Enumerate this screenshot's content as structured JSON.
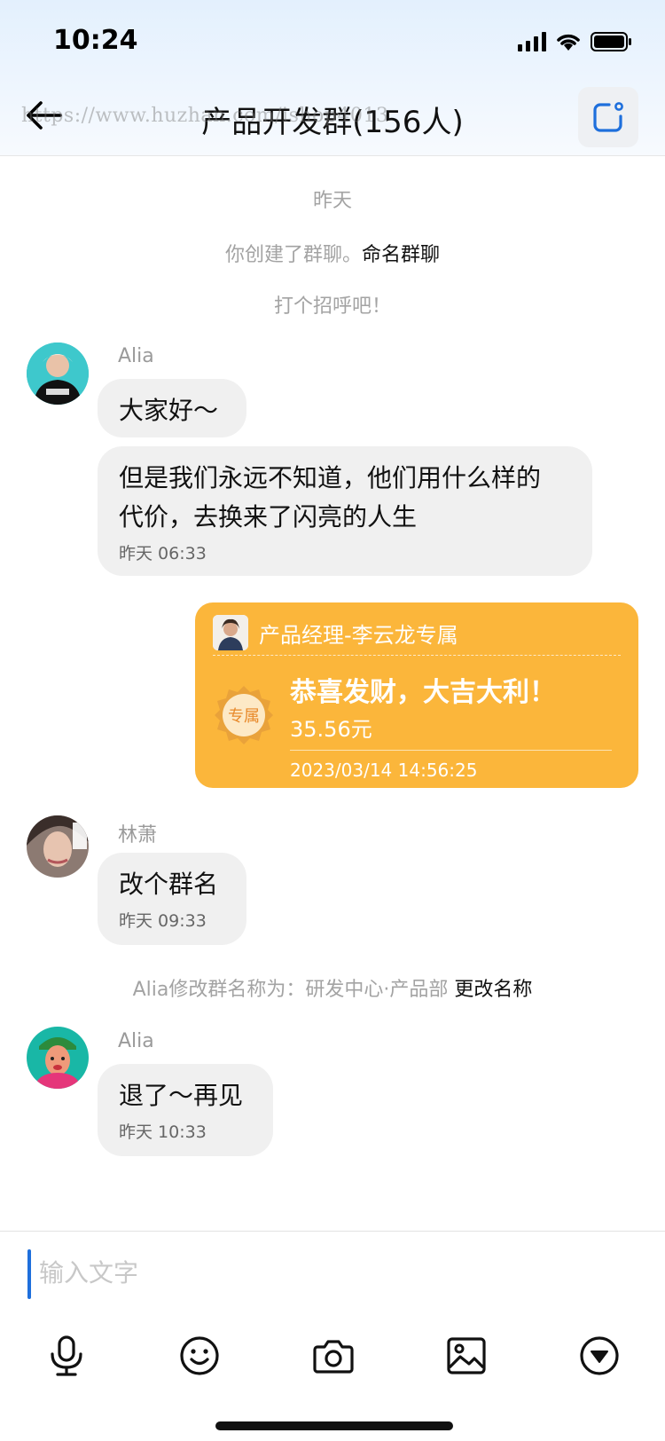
{
  "status_bar": {
    "time": "10:24"
  },
  "nav": {
    "title": "产品开发群(156人)",
    "watermark": "https://www.huzhan.com/ishop4013"
  },
  "system": {
    "date_label": "昨天",
    "created_text": "你创建了群聊。",
    "rename_link": "命名群聊",
    "greet_hint": "打个招呼吧！",
    "renamed_text": "Alia修改群名称为：研发中心·产品部",
    "change_name_link": "更改名称"
  },
  "messages": [
    {
      "sender": "Alia",
      "text": "大家好～"
    },
    {
      "text_line1": "但是我们永远不知道，他们用什么样的",
      "text_line2": "代价，去换来了闪亮的人生",
      "time": "昨天 06:33"
    },
    {
      "sender": "林萧",
      "text": "改个群名",
      "time": "昨天 09:33"
    },
    {
      "sender": "Alia",
      "text": "退了～再见",
      "time": "昨天 10:33"
    }
  ],
  "packet": {
    "sender": "产品经理-李云龙专属",
    "seal_text": "专属",
    "greeting": "恭喜发财，大吉大利！",
    "amount": "35.56元",
    "datetime": "2023/03/14 14:56:25"
  },
  "input": {
    "placeholder": "输入文字"
  },
  "toolbar": {
    "icons": [
      "microphone-icon",
      "emoji-icon",
      "camera-icon",
      "image-icon",
      "more-icon"
    ]
  },
  "colors": {
    "accent": "#1e6fdc",
    "packet": "#fbb63b",
    "bubble": "#f0f0f0",
    "muted_text": "#a3a3a3"
  }
}
